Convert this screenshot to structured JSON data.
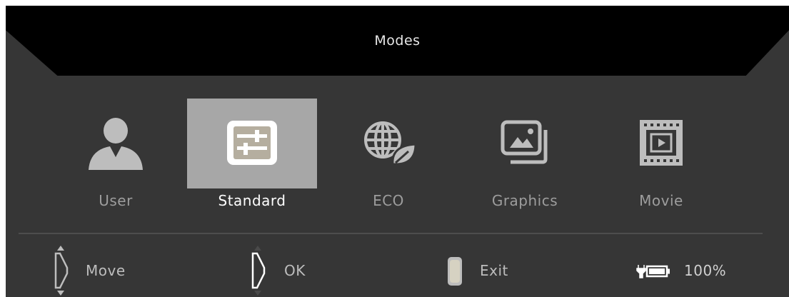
{
  "header": {
    "title": "Modes"
  },
  "modes": [
    {
      "label": "User",
      "icon": "user-icon",
      "selected": false
    },
    {
      "label": "Standard",
      "icon": "sliders-icon",
      "selected": true
    },
    {
      "label": "ECO",
      "icon": "eco-globe-leaf-icon",
      "selected": false
    },
    {
      "label": "Graphics",
      "icon": "picture-gallery-icon",
      "selected": false
    },
    {
      "label": "Movie",
      "icon": "film-play-icon",
      "selected": false
    }
  ],
  "footer": {
    "move_label": "Move",
    "ok_label": "OK",
    "exit_label": "Exit",
    "battery_label": "100%"
  },
  "colors": {
    "background": "#363636",
    "header": "#000000",
    "selected_tile": "#a7a7a7",
    "icon": "#bdbdbd",
    "label": "#9d9d9d",
    "selected_label": "#ffffff"
  }
}
